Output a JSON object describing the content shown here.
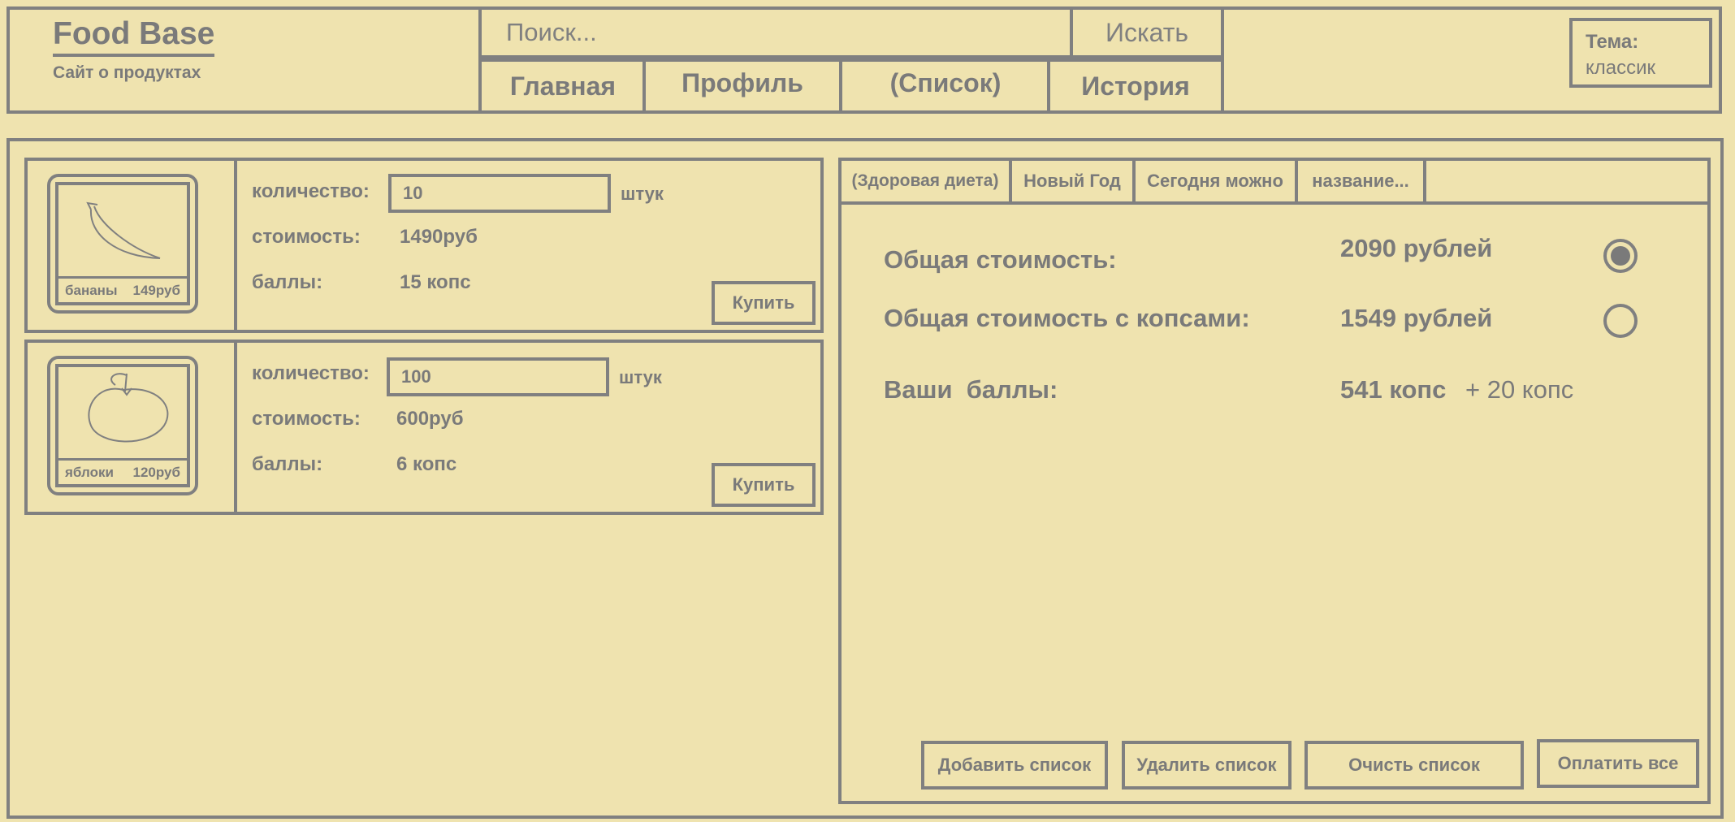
{
  "header": {
    "title": "Food Base",
    "subtitle": "Сайт о продуктах",
    "search_placeholder": "Поиск...",
    "search_button": "Искать",
    "nav": [
      "Главная",
      "Профиль",
      "(Список)",
      "История"
    ],
    "theme_label": "Тема:",
    "theme_value": "классик"
  },
  "products": [
    {
      "name": "бананы",
      "price": "149руб",
      "icon": "banana-sketch",
      "qty_label": "количество:",
      "qty_value": "10",
      "qty_unit": "штук",
      "cost_label": "стоимость:",
      "cost_value": "1490руб",
      "points_label": "баллы:",
      "points_value": "15 копс",
      "buy": "Купить"
    },
    {
      "name": "яблоки",
      "price": "120руб",
      "icon": "apple-sketch",
      "qty_label": "количество:",
      "qty_value": "100",
      "qty_unit": "штук",
      "cost_label": "стоимость:",
      "cost_value": "600руб",
      "points_label": "баллы:",
      "points_value": "6 копс",
      "buy": "Купить"
    }
  ],
  "lists": {
    "tabs": [
      "(Здоровая диета)",
      "Новый Год",
      "Сегодня можно",
      "название..."
    ],
    "total_label": "Общая стоимость:",
    "total_value": "2090 рублей",
    "total_points_label": "Общая стоимость с копсами:",
    "total_points_value": "1549 рублей",
    "points_label": "Ваши  баллы:",
    "points_value": "541 копс",
    "points_bonus": "+ 20 копс",
    "selected_option": "total",
    "buttons": [
      "Добавить список",
      "Удалить список",
      "Очисть список",
      "Оплатить все"
    ]
  },
  "colors": {
    "background": "#efe3af",
    "border": "#808080",
    "text": "#7a7a7a"
  }
}
